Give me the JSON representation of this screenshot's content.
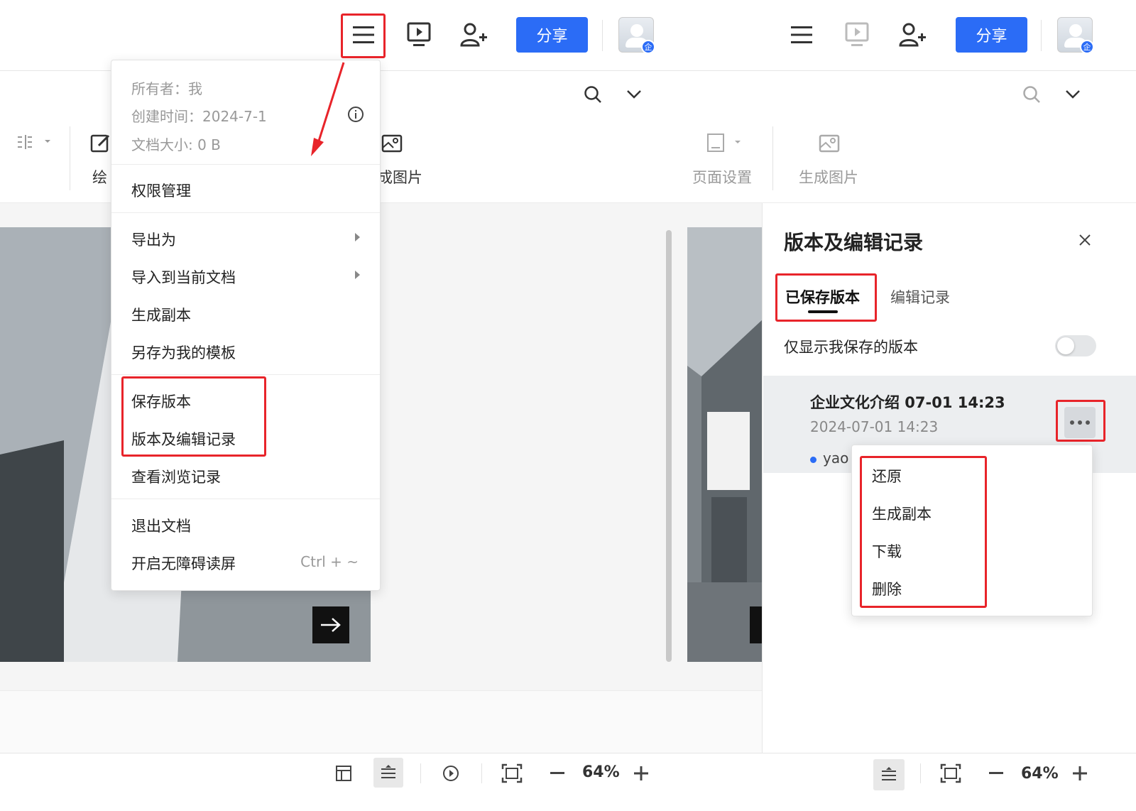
{
  "left": {
    "header": {
      "share_label": "分享",
      "avatar_badge": "企"
    },
    "toolbar": {
      "draw_label": "绘",
      "generate_image_label_partial": "成图片"
    },
    "menu": {
      "meta": {
        "owner": "所有者：我",
        "created": "创建时间：2024-7-1",
        "size": "文档大小: 0 B"
      },
      "items": {
        "permissions": "权限管理",
        "export": "导出为",
        "import": "导入到当前文档",
        "duplicate": "生成副本",
        "save_as_template": "另存为我的模板",
        "save_version": "保存版本",
        "version_history": "版本及编辑记录",
        "view_history": "查看浏览记录",
        "exit": "退出文档",
        "accessibility": "开启无障碍读屏",
        "accessibility_shortcut": "Ctrl + ~"
      }
    },
    "status": {
      "zoom": "64%"
    }
  },
  "right": {
    "header": {
      "share_label": "分享",
      "avatar_badge": "企"
    },
    "toolbar": {
      "page_setup_label": "页面设置",
      "generate_image_label": "生成图片"
    },
    "panel": {
      "title": "版本及编辑记录",
      "tabs": [
        "已保存版本",
        "编辑记录"
      ],
      "only_mine_label": "仅显示我保存的版本",
      "only_mine_enabled": false,
      "version": {
        "name": "企业文化介绍  07-01 14:23",
        "time": "2024-07-01 14:23",
        "user": "yao"
      }
    },
    "context_menu": {
      "items": [
        "还原",
        "生成副本",
        "下载",
        "删除"
      ]
    },
    "status": {
      "zoom": "64%"
    }
  },
  "colors": {
    "accent": "#2b6cf6",
    "highlight": "#e8242a"
  }
}
